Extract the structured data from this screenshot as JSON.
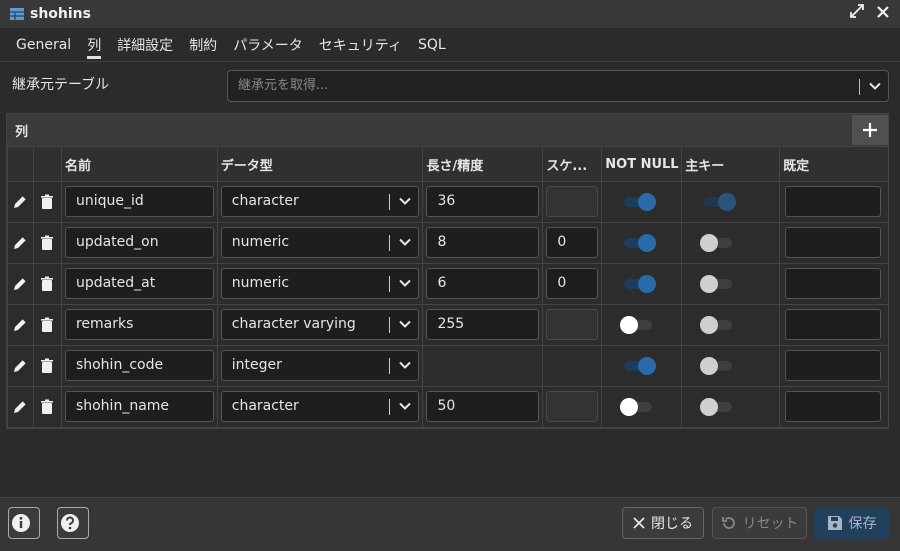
{
  "window": {
    "title": "shohins",
    "icon": "table-icon"
  },
  "tabs": [
    {
      "label": "General",
      "active": false
    },
    {
      "label": "列",
      "active": true
    },
    {
      "label": "詳細設定",
      "active": false
    },
    {
      "label": "制約",
      "active": false
    },
    {
      "label": "パラメータ",
      "active": false
    },
    {
      "label": "セキュリティ",
      "active": false
    },
    {
      "label": "SQL",
      "active": false
    }
  ],
  "inherit": {
    "label": "継承元テーブル",
    "placeholder": "継承元を取得..."
  },
  "columns_panel": {
    "label": "列",
    "headers": {
      "name": "名前",
      "type": "データ型",
      "length": "長さ/精度",
      "scale": "スケ...",
      "not_null": "NOT NULL",
      "primary_key": "主キー",
      "default": "既定"
    },
    "rows": [
      {
        "name": "unique_id",
        "type": "character",
        "length": "36",
        "scale": "",
        "not_null": true,
        "primary_key": true,
        "default": ""
      },
      {
        "name": "updated_on",
        "type": "numeric",
        "length": "8",
        "scale": "0",
        "not_null": true,
        "primary_key": false,
        "default": ""
      },
      {
        "name": "updated_at",
        "type": "numeric",
        "length": "6",
        "scale": "0",
        "not_null": true,
        "primary_key": false,
        "default": ""
      },
      {
        "name": "remarks",
        "type": "character varying",
        "length": "255",
        "scale": "",
        "not_null": false,
        "primary_key": false,
        "default": ""
      },
      {
        "name": "shohin_code",
        "type": "integer",
        "length": "",
        "scale": "",
        "not_null": true,
        "primary_key": false,
        "default": ""
      },
      {
        "name": "shohin_name",
        "type": "character",
        "length": "50",
        "scale": "",
        "not_null": false,
        "primary_key": false,
        "default": ""
      }
    ]
  },
  "footer": {
    "close_label": "閉じる",
    "reset_label": "リセット",
    "save_label": "保存"
  },
  "colors": {
    "accent": "#2a6aa6",
    "background": "#2b2b2b",
    "save_bg": "#20405e"
  }
}
